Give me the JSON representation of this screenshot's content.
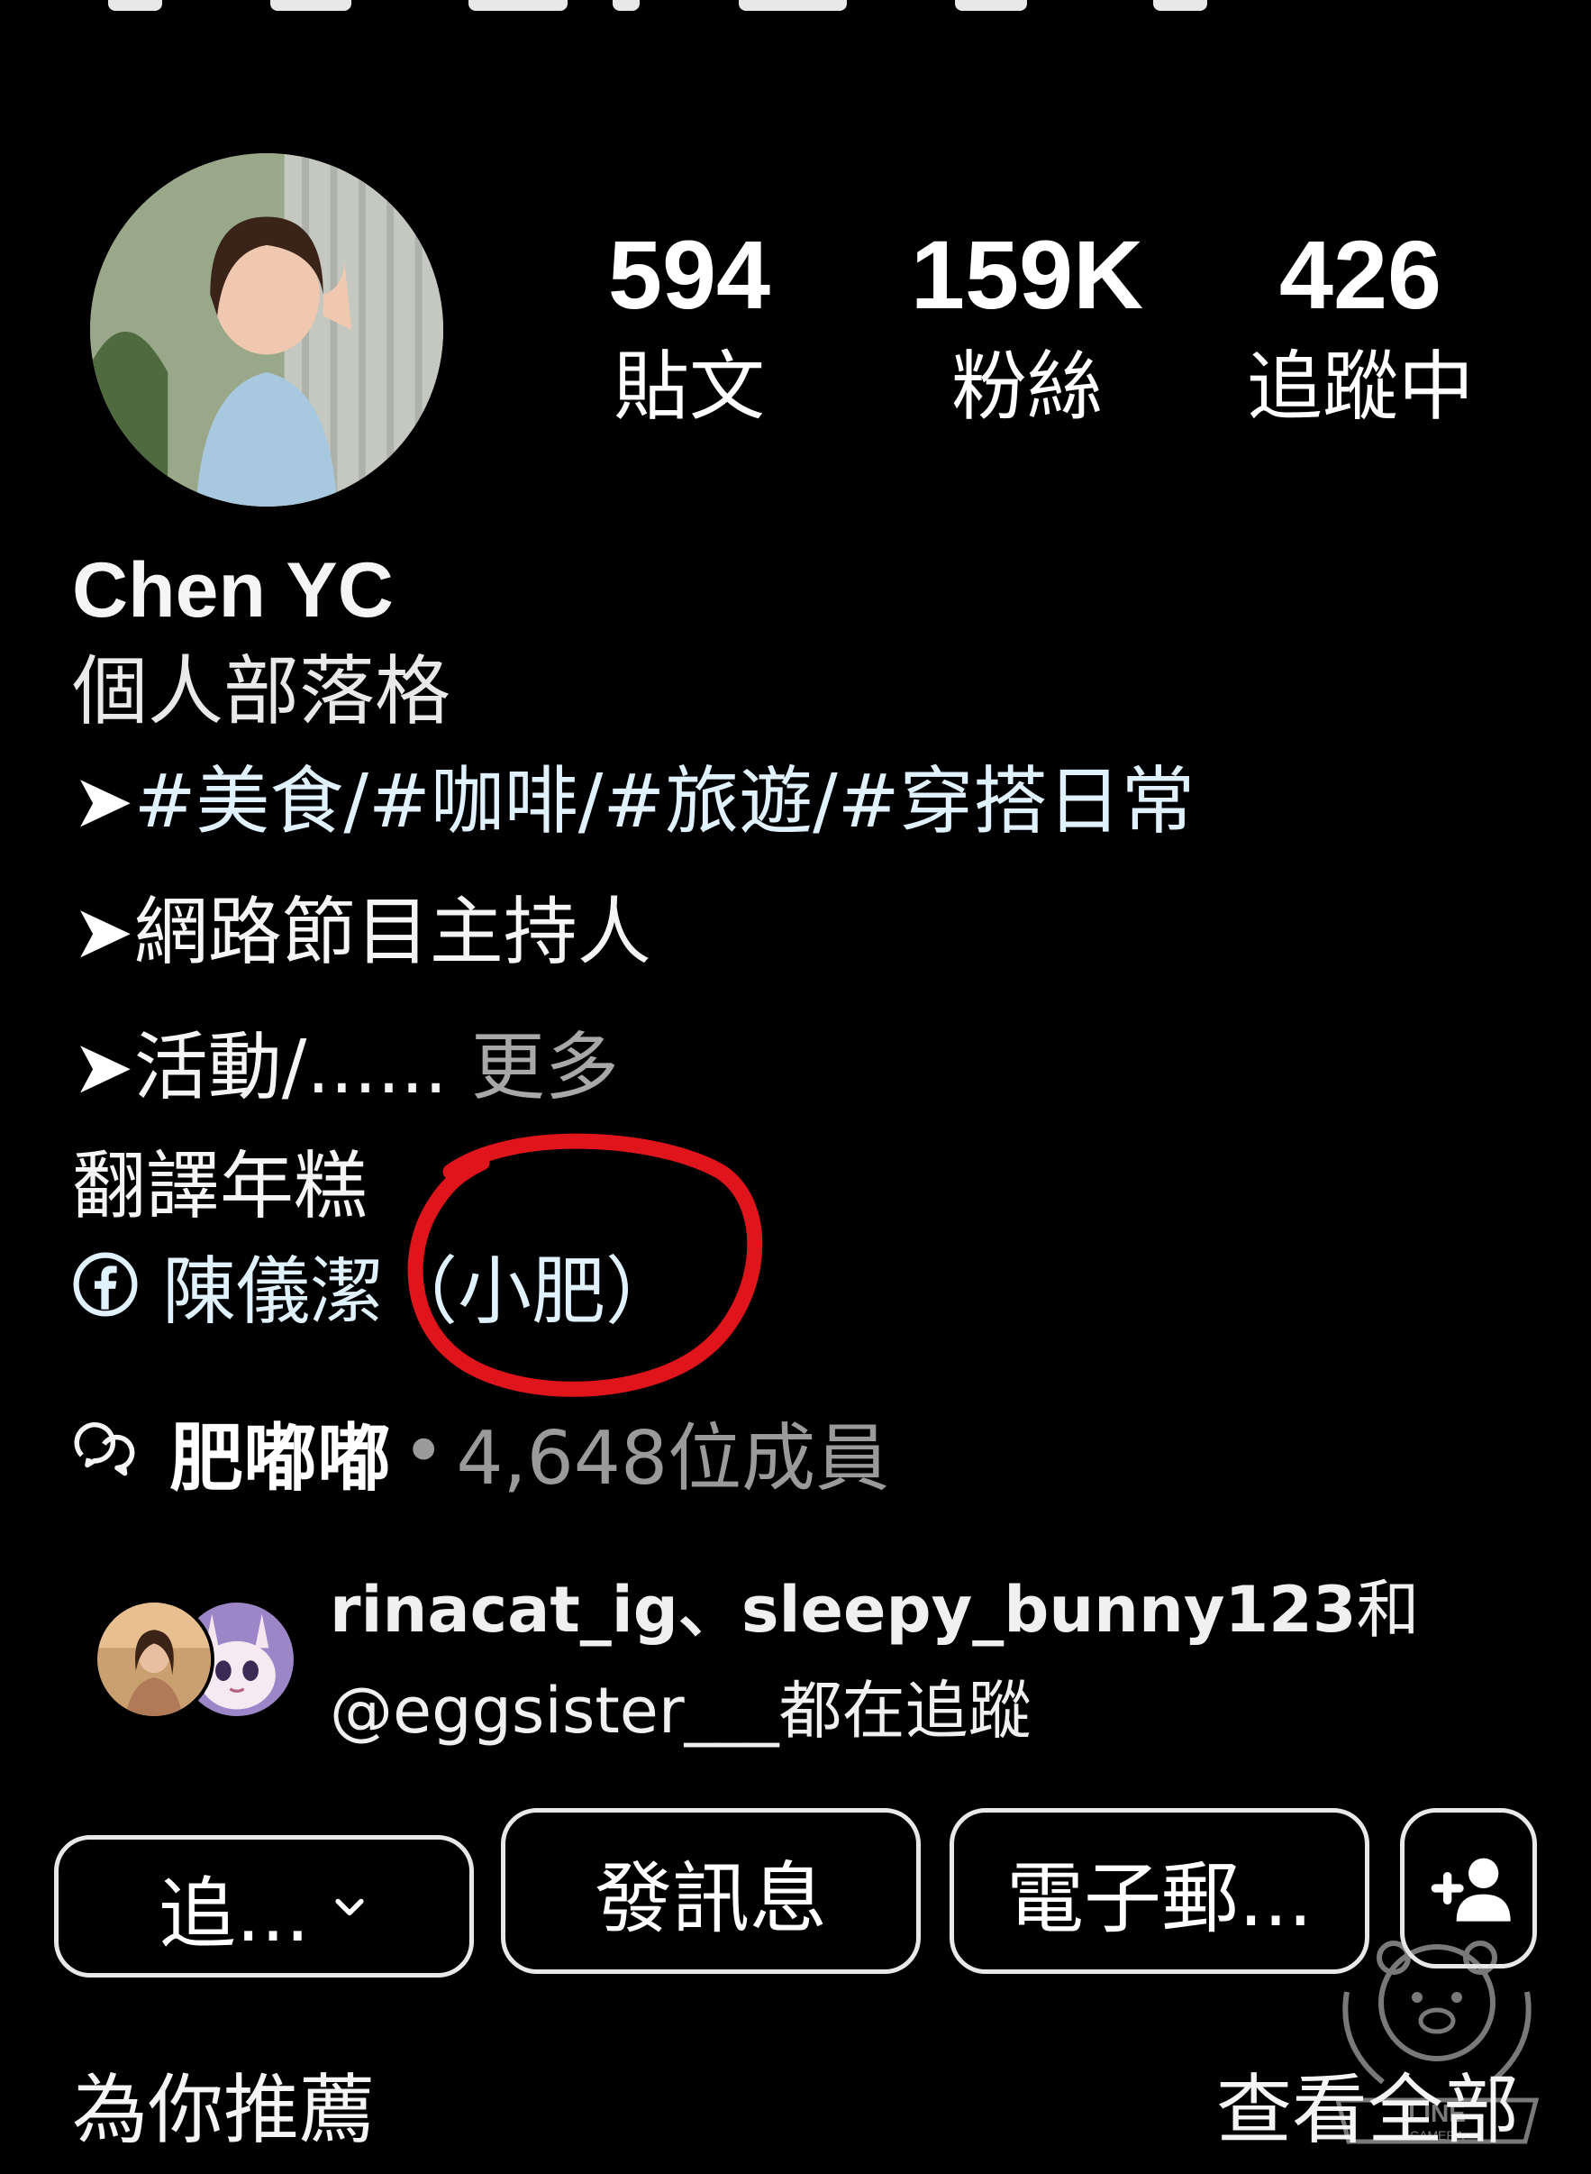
{
  "profile": {
    "stats": [
      {
        "value": "594",
        "label": "貼文"
      },
      {
        "value": "159K",
        "label": "粉絲"
      },
      {
        "value": "426",
        "label": "追蹤中"
      }
    ],
    "name": "Chen YC",
    "category": "個人部落格",
    "bio": {
      "arrow": "➤",
      "line1": "#美食/#咖啡/#旅遊/#穿搭日常",
      "line2": "網路節目主持人",
      "line3": "活動/......",
      "more": "更多",
      "line4": "翻譯年糕"
    },
    "facebook_link": "陳儀潔（小肥）",
    "group": {
      "name": "肥嘟嘟",
      "separator": "•",
      "members": "4,648位成員"
    },
    "followed_by": {
      "users": "rinacat_ig、sleepy_bunny123",
      "and": "和",
      "line2": "@eggsister___都在追蹤"
    }
  },
  "actions": {
    "follow_label": "追...",
    "message_label": "發訊息",
    "email_label": "電子郵..."
  },
  "footer": {
    "suggested": "為你推薦",
    "see_all": "查看全部"
  },
  "watermark": {
    "text1": "LINE",
    "text2": "CAMERA"
  },
  "icons": {
    "facebook": "facebook-icon",
    "chat": "chat-bubbles-icon",
    "chevron": "chevron-down-icon",
    "add_person": "add-person-icon"
  },
  "colors": {
    "background": "#000000",
    "link": "#e0f1ff",
    "muted": "#9a9a9a",
    "annotation": "#e0151b"
  }
}
